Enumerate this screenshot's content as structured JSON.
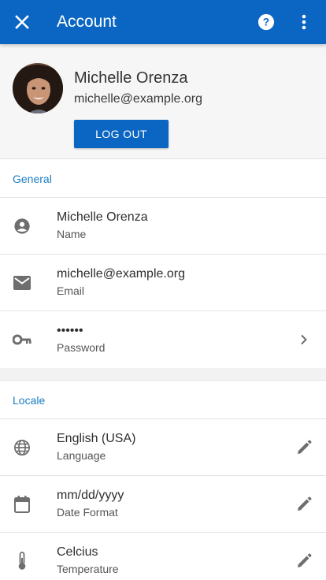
{
  "app_bar": {
    "title": "Account",
    "close_icon": "close-icon",
    "help_icon": "help-icon",
    "more_icon": "more-vert-icon",
    "color": "#0a66c2"
  },
  "profile": {
    "name": "Michelle Orenza",
    "email": "michelle@example.org",
    "logout_label": "LOG OUT"
  },
  "general": {
    "header": "General",
    "items": [
      {
        "icon": "person-icon",
        "value": "Michelle Orenza",
        "label": "Name"
      },
      {
        "icon": "mail-icon",
        "value": "michelle@example.org",
        "label": "Email"
      },
      {
        "icon": "key-icon",
        "value": "••••••",
        "label": "Password",
        "trailing_icon": "chevron-right-icon"
      }
    ]
  },
  "locale": {
    "header": "Locale",
    "items": [
      {
        "icon": "globe-icon",
        "value": "English (USA)",
        "label": "Language",
        "trailing_icon": "edit-icon"
      },
      {
        "icon": "calendar-icon",
        "value": "mm/dd/yyyy",
        "label": "Date Format",
        "trailing_icon": "edit-icon"
      },
      {
        "icon": "thermometer-icon",
        "value": "Celcius",
        "label": "Temperature",
        "trailing_icon": "edit-icon"
      }
    ]
  },
  "colors": {
    "accent": "#0a66c2",
    "section_header": "#1a7dc4"
  }
}
